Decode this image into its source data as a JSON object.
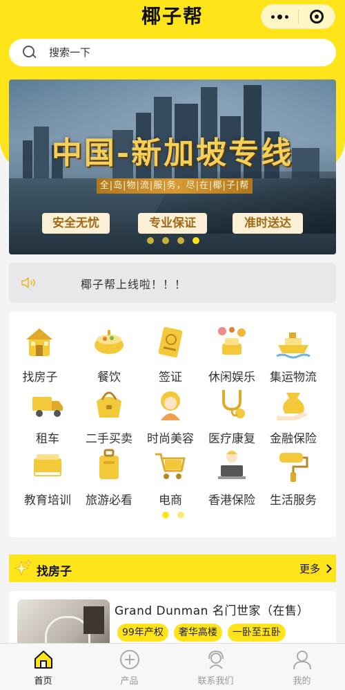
{
  "app": {
    "title": "椰子帮"
  },
  "search": {
    "placeholder": "搜索一下"
  },
  "banner": {
    "title": "中国-新加坡专线",
    "subtitle": "全|岛|物|流|服|务，尽|在|椰|子|帮",
    "tags": [
      "安全无忧",
      "专业保证",
      "准时送达"
    ],
    "slide_count": 4,
    "active_slide": 4
  },
  "notice": {
    "text": "椰子帮上线啦！！！"
  },
  "categories": [
    {
      "label": "找房子",
      "icon": "house-icon"
    },
    {
      "label": "餐饮",
      "icon": "food-pot-icon"
    },
    {
      "label": "签证",
      "icon": "passport-icon"
    },
    {
      "label": "休闲娱乐",
      "icon": "cake-party-icon"
    },
    {
      "label": "集运物流",
      "icon": "ship-icon"
    },
    {
      "label": "租车",
      "icon": "truck-icon"
    },
    {
      "label": "二手买卖",
      "icon": "handbag-icon"
    },
    {
      "label": "时尚美容",
      "icon": "beauty-girl-icon"
    },
    {
      "label": "医疗康复",
      "icon": "stethoscope-icon"
    },
    {
      "label": "金融保险",
      "icon": "money-bag-hand-icon"
    },
    {
      "label": "教育培训",
      "icon": "book-icon"
    },
    {
      "label": "旅游必看",
      "icon": "suitcase-icon"
    },
    {
      "label": "电商",
      "icon": "shopping-cart-icon"
    },
    {
      "label": "香港保险",
      "icon": "agent-laptop-icon"
    },
    {
      "label": "生活服务",
      "icon": "paint-roller-icon"
    }
  ],
  "category_pager": {
    "pages": 2,
    "active": 1
  },
  "section": {
    "title": "找房子",
    "more": "更多"
  },
  "listing": {
    "title": "Grand Dunman 名门世家（在售）",
    "tags": [
      "99年产权",
      "奢华高楼",
      "一卧至五卧"
    ]
  },
  "tabbar": [
    {
      "label": "首页",
      "icon": "home-icon",
      "active": true
    },
    {
      "label": "产品",
      "icon": "plus-circle-icon",
      "active": false
    },
    {
      "label": "联系我们",
      "icon": "headset-icon",
      "active": false
    },
    {
      "label": "我的",
      "icon": "user-icon",
      "active": false
    }
  ],
  "colors": {
    "brand_yellow": "#ffe419",
    "banner_gold": "#f6cf56",
    "tag_brown": "#a16a16"
  }
}
